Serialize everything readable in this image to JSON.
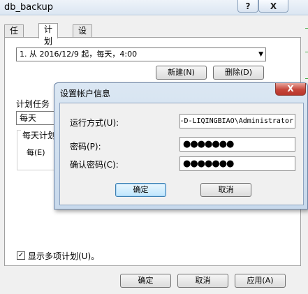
{
  "window": {
    "title": "db_backup",
    "help_glyph": "?",
    "close_glyph": "X"
  },
  "tabs": [
    {
      "label": "任务"
    },
    {
      "label": "计划"
    },
    {
      "label": "设置"
    }
  ],
  "schedule": {
    "selected": "1. 从 2016/12/9 起，每天，4:00",
    "new_button": "新建(N)",
    "delete_button": "删除(D)"
  },
  "plan_task": {
    "label": "计划任务",
    "value": "每天",
    "group_label": "每天计划",
    "every_label": "每(E)"
  },
  "multi_schedule": {
    "checked": true,
    "check_glyph": "✓",
    "label": "显示多项计划(U)。"
  },
  "footer": {
    "ok": "确定",
    "cancel": "取消",
    "apply": "应用(A)"
  },
  "dialog": {
    "title": "设置帐户信息",
    "close_glyph": "X",
    "run_as_label": "运行方式(U):",
    "run_as_value": "-D-LIQINGBIAO\\Administrator",
    "password_label": "密码(P):",
    "password_mask": "●●●●●●●",
    "confirm_label": "确认密码(C):",
    "confirm_mask": "●●●●●●●",
    "ok": "确定",
    "cancel": "取消"
  },
  "colors": {
    "accent": "#c6463a",
    "title_bar": "#dbe6f2"
  }
}
